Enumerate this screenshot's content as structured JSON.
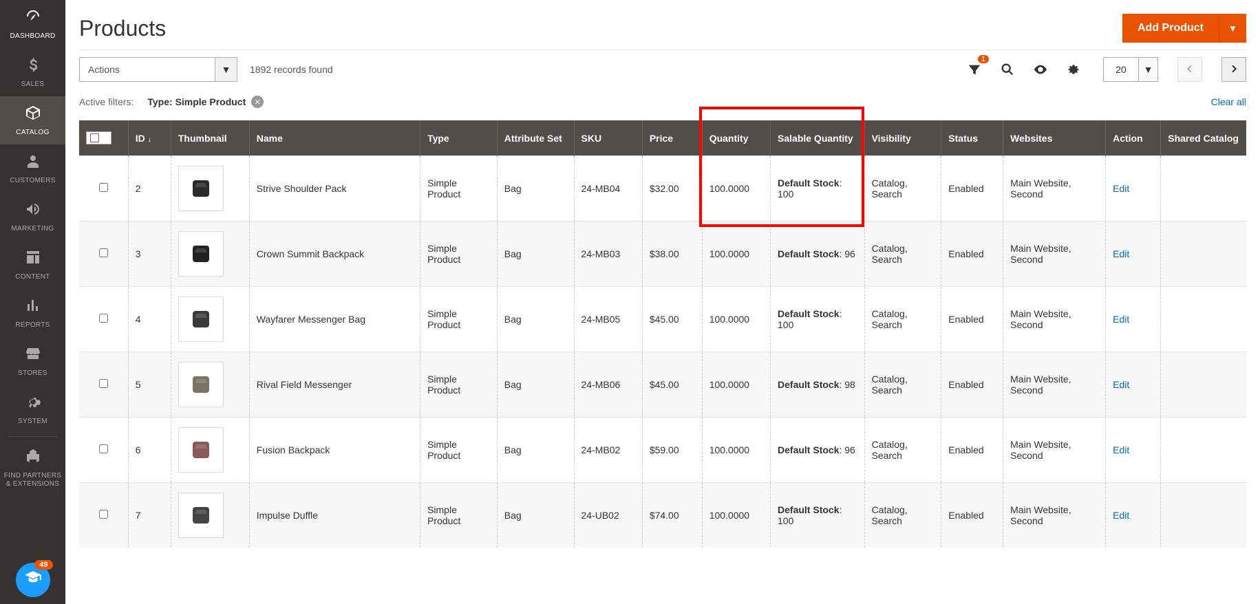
{
  "sidebar": {
    "items": [
      {
        "label": "DASHBOARD"
      },
      {
        "label": "SALES"
      },
      {
        "label": "CATALOG"
      },
      {
        "label": "CUSTOMERS"
      },
      {
        "label": "MARKETING"
      },
      {
        "label": "CONTENT"
      },
      {
        "label": "REPORTS"
      },
      {
        "label": "STORES"
      },
      {
        "label": "SYSTEM"
      }
    ],
    "find_partners_line1": "FIND PARTNERS",
    "find_partners_line2": "& EXTENSIONS",
    "help_badge": "49"
  },
  "page": {
    "title": "Products",
    "add_button": "Add Product"
  },
  "toolbar": {
    "actions_label": "Actions",
    "records_found": "1892 records found",
    "filter_count": "1",
    "page_size": "20"
  },
  "filters": {
    "active_label": "Active filters:",
    "chip_prefix": "Type: ",
    "chip_value": "Simple Product",
    "clear_all": "Clear all"
  },
  "columns": {
    "id": "ID",
    "thumbnail": "Thumbnail",
    "name": "Name",
    "type": "Type",
    "attribute_set": "Attribute Set",
    "sku": "SKU",
    "price": "Price",
    "quantity": "Quantity",
    "salable_quantity": "Salable Quantity",
    "visibility": "Visibility",
    "status": "Status",
    "websites": "Websites",
    "action": "Action",
    "shared_catalog": "Shared Catalog"
  },
  "rows": [
    {
      "id": "2",
      "name": "Strive Shoulder Pack",
      "type": "Simple Product",
      "attr": "Bag",
      "sku": "24-MB04",
      "price": "$32.00",
      "qty": "100.0000",
      "salable_label": "Default Stock",
      "salable_value": ": 100",
      "visibility": "Catalog, Search",
      "status": "Enabled",
      "websites": "Main Website, Second",
      "action": "Edit",
      "thumb_color": "#2a2a2a"
    },
    {
      "id": "3",
      "name": "Crown Summit Backpack",
      "type": "Simple Product",
      "attr": "Bag",
      "sku": "24-MB03",
      "price": "$38.00",
      "qty": "100.0000",
      "salable_label": "Default Stock",
      "salable_value": ": 96",
      "visibility": "Catalog, Search",
      "status": "Enabled",
      "websites": "Main Website, Second",
      "action": "Edit",
      "thumb_color": "#222"
    },
    {
      "id": "4",
      "name": "Wayfarer Messenger Bag",
      "type": "Simple Product",
      "attr": "Bag",
      "sku": "24-MB05",
      "price": "$45.00",
      "qty": "100.0000",
      "salable_label": "Default Stock",
      "salable_value": ": 100",
      "visibility": "Catalog, Search",
      "status": "Enabled",
      "websites": "Main Website, Second",
      "action": "Edit",
      "thumb_color": "#3a3a3a"
    },
    {
      "id": "5",
      "name": "Rival Field Messenger",
      "type": "Simple Product",
      "attr": "Bag",
      "sku": "24-MB06",
      "price": "$45.00",
      "qty": "100.0000",
      "salable_label": "Default Stock",
      "salable_value": ": 98",
      "visibility": "Catalog, Search",
      "status": "Enabled",
      "websites": "Main Website, Second",
      "action": "Edit",
      "thumb_color": "#7a7367"
    },
    {
      "id": "6",
      "name": "Fusion Backpack",
      "type": "Simple Product",
      "attr": "Bag",
      "sku": "24-MB02",
      "price": "$59.00",
      "qty": "100.0000",
      "salable_label": "Default Stock",
      "salable_value": ": 96",
      "visibility": "Catalog, Search",
      "status": "Enabled",
      "websites": "Main Website, Second",
      "action": "Edit",
      "thumb_color": "#8a5a5a"
    },
    {
      "id": "7",
      "name": "Impulse Duffle",
      "type": "Simple Product",
      "attr": "Bag",
      "sku": "24-UB02",
      "price": "$74.00",
      "qty": "100.0000",
      "salable_label": "Default Stock",
      "salable_value": ": 100",
      "visibility": "Catalog, Search",
      "status": "Enabled",
      "websites": "Main Website, Second",
      "action": "Edit",
      "thumb_color": "#444"
    }
  ]
}
